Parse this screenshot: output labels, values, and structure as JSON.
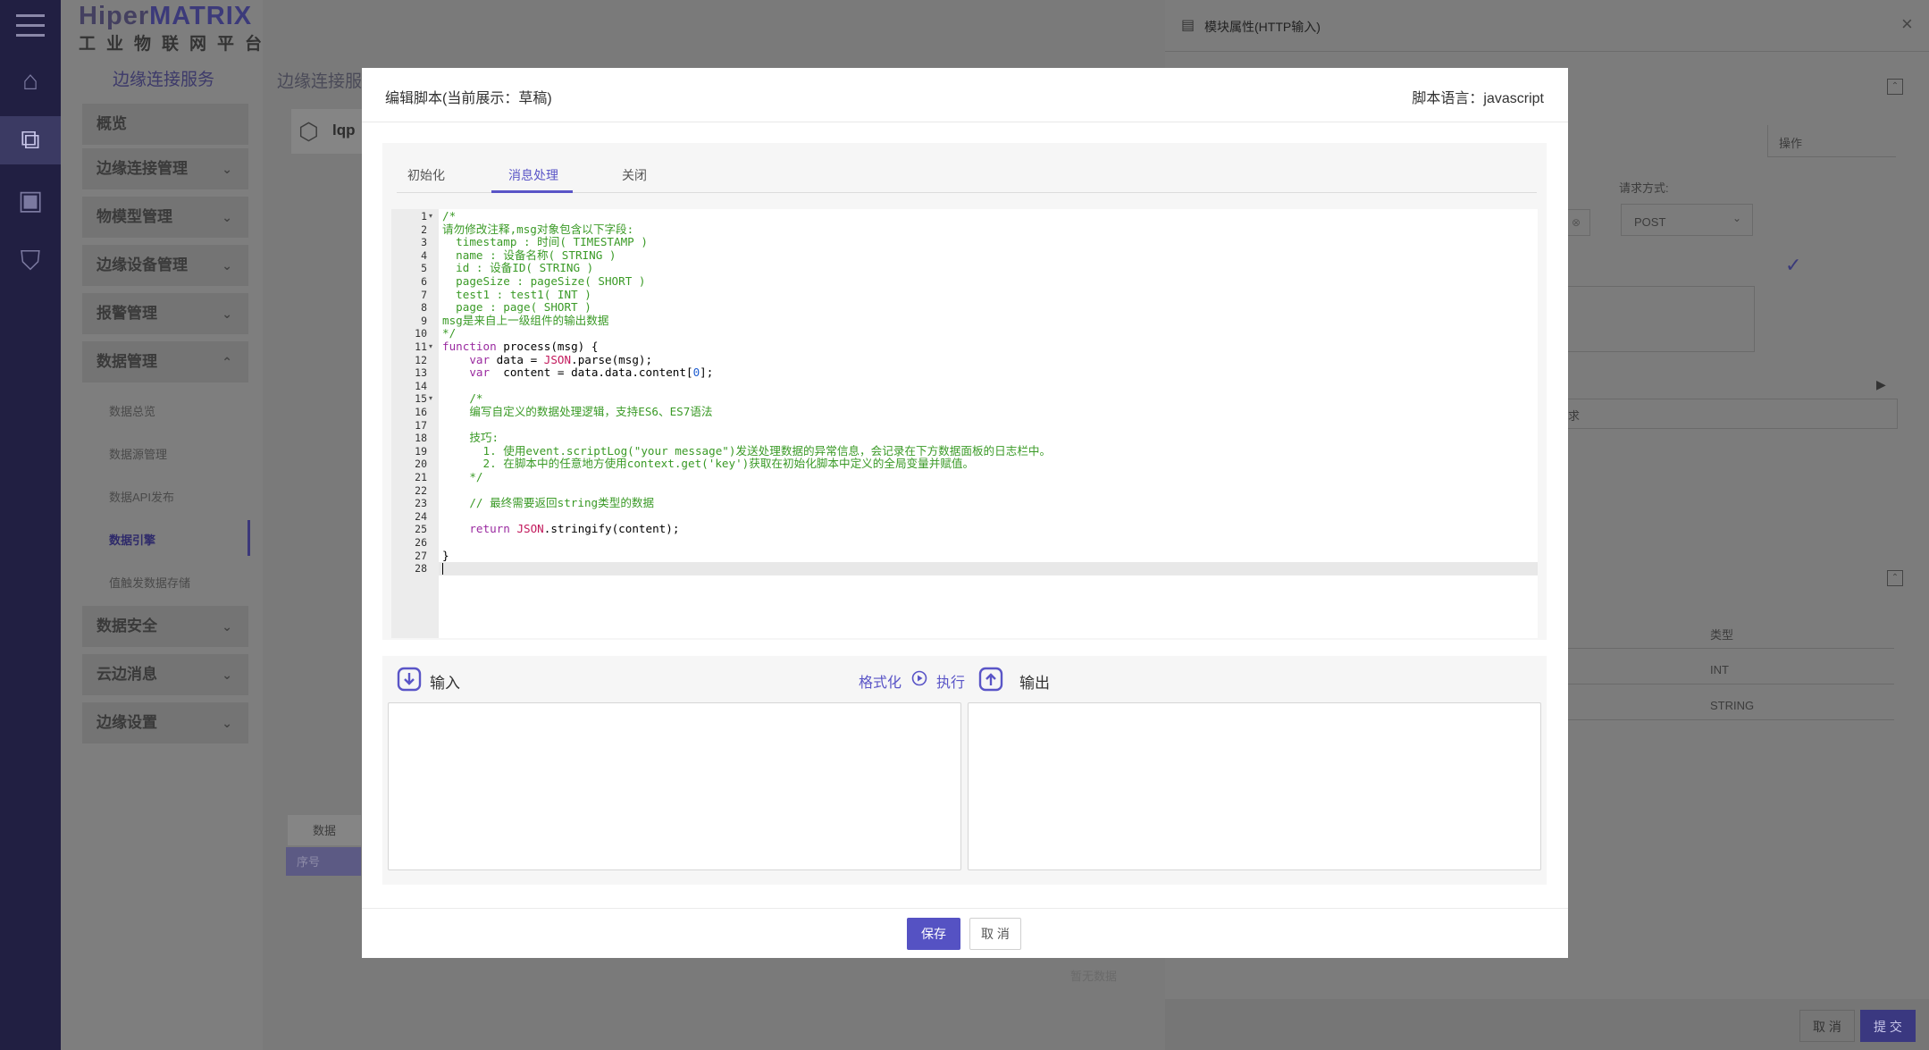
{
  "brand": {
    "prefix": "Hiper",
    "name": "MATRIX",
    "subtitle": "工业物联网平台"
  },
  "sidebar": {
    "section": "边缘连接服务",
    "menus": [
      {
        "label": "概览"
      },
      {
        "label": "边缘连接管理"
      },
      {
        "label": "物模型管理"
      },
      {
        "label": "边缘设备管理"
      },
      {
        "label": "报警管理"
      },
      {
        "label": "数据管理"
      },
      {
        "label": "数据安全"
      },
      {
        "label": "云边消息"
      },
      {
        "label": "边缘设置"
      }
    ],
    "submenus": [
      {
        "label": "数据总览"
      },
      {
        "label": "数据源管理"
      },
      {
        "label": "数据API发布"
      },
      {
        "label": "数据引擎"
      },
      {
        "label": "值触发数据存储"
      }
    ]
  },
  "background": {
    "breadcrumb": "边缘连接服",
    "card_title": "lqp",
    "table_tab": "数据",
    "table_col": "序号",
    "empty": "暂无数据"
  },
  "right_panel": {
    "title": "模块属性(HTTP输入)",
    "op_header": "操作",
    "method_label": "请求方式:",
    "method_value": "POST",
    "desc_tail": "求",
    "type_header": "类型",
    "type_rows": [
      "INT",
      "STRING"
    ],
    "cancel": "取 消",
    "submit": "提 交"
  },
  "modal": {
    "title": "编辑脚本(当前展示：草稿)",
    "language": "脚本语言：javascript",
    "tabs": [
      {
        "label": "初始化"
      },
      {
        "label": "消息处理"
      },
      {
        "label": "关闭"
      }
    ],
    "active_tab": "消息处理",
    "input_label": "输入",
    "format": "格式化",
    "run": "执行",
    "output_label": "输出",
    "save": "保存",
    "cancel": "取 消"
  },
  "code_lines": [
    "/*",
    "请勿修改注释,msg对象包含以下字段:",
    "  timestamp : 时间( TIMESTAMP )",
    "  name : 设备名称( STRING )",
    "  id : 设备ID( STRING )",
    "  pageSize : pageSize( SHORT )",
    "  test1 : test1( INT )",
    "  page : page( SHORT )",
    "msg是来自上一级组件的输出数据",
    "*/",
    "function process(msg) {",
    "    var data = JSON.parse(msg);",
    "    var  content = data.data.content[0];",
    "",
    "    /*",
    "    编写自定义的数据处理逻辑，支持ES6、ES7语法",
    "",
    "    技巧:",
    "      1. 使用event.scriptLog(\"your message\")发送处理数据的异常信息，会记录在下方数据面板的日志栏中。",
    "      2. 在脚本中的任意地方使用context.get('key')获取在初始化脚本中定义的全局变量并赋值。",
    "    */",
    "",
    "    // 最终需要返回string类型的数据",
    "",
    "    return JSON.stringify(content);",
    "",
    "}",
    ""
  ]
}
